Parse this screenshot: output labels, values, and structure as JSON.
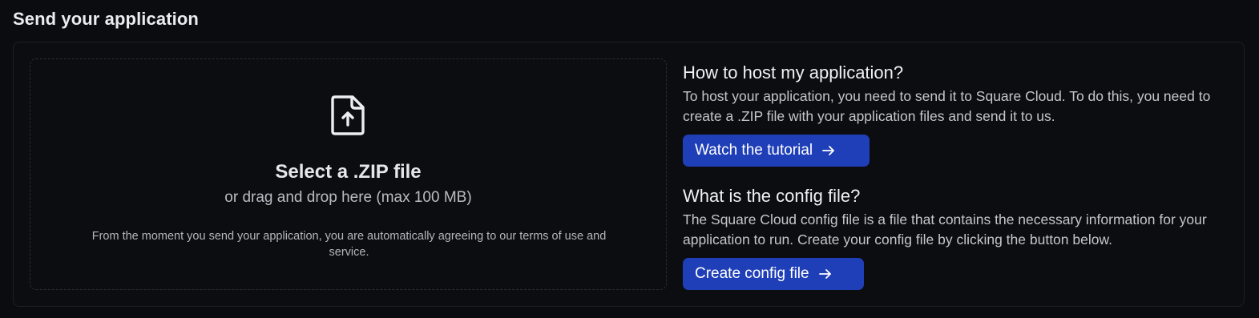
{
  "page": {
    "title": "Send your application"
  },
  "dropzone": {
    "icon": "file-upload-icon",
    "title": "Select a .ZIP file",
    "subtitle": "or drag and drop here (max 100 MB)",
    "terms_note": "From the moment you send your application, you are automatically agreeing to our terms of use and service."
  },
  "host_section": {
    "heading": "How to host my application?",
    "description": "To host your application, you need to send it to Square Cloud. To do this, you need to create a .ZIP file with your application files and send it to us.",
    "button_label": "Watch the tutorial",
    "button_icon": "arrow-right-icon"
  },
  "config_section": {
    "heading": "What is the config file?",
    "description": "The Square Cloud config file is a file that contains the necessary information for your application to run. Create your config file by clicking the button below.",
    "button_label": "Create config file",
    "button_icon": "arrow-right-icon"
  },
  "colors": {
    "background": "#0b0c0f",
    "accent_button": "#1f3fb8",
    "dashed_border": "#2a2d35"
  }
}
